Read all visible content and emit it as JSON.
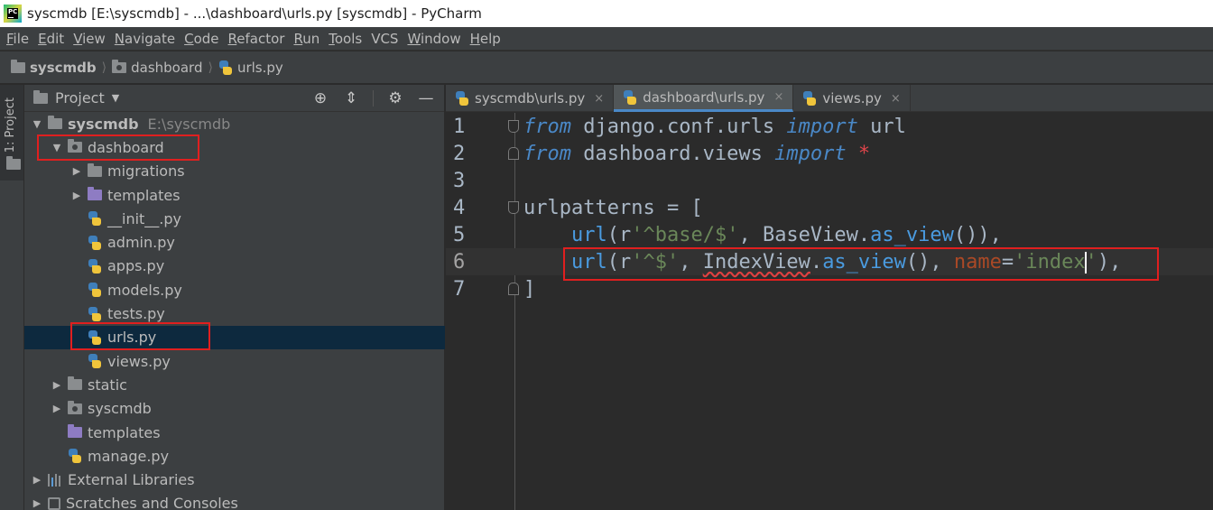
{
  "window": {
    "title": "syscmdb [E:\\syscmdb] - ...\\dashboard\\urls.py [syscmdb] - PyCharm",
    "app_icon_text": "PC"
  },
  "menu": {
    "items": [
      {
        "mnemonic": "F",
        "rest": "ile"
      },
      {
        "mnemonic": "E",
        "rest": "dit"
      },
      {
        "mnemonic": "V",
        "rest": "iew"
      },
      {
        "mnemonic": "N",
        "rest": "avigate"
      },
      {
        "mnemonic": "C",
        "rest": "ode"
      },
      {
        "mnemonic": "R",
        "rest": "efactor"
      },
      {
        "mnemonic": "R",
        "rest": "un"
      },
      {
        "mnemonic": "T",
        "rest": "ools"
      },
      {
        "mnemonic": "",
        "rest": "VCS"
      },
      {
        "mnemonic": "W",
        "rest": "indow"
      },
      {
        "mnemonic": "H",
        "rest": "elp"
      }
    ]
  },
  "breadcrumb": {
    "items": [
      "syscmdb",
      "dashboard",
      "urls.py"
    ]
  },
  "toolstrip": {
    "project_tab": "1: Project"
  },
  "project_panel": {
    "title": "Project",
    "tree": [
      {
        "indent": 0,
        "arrow": "open",
        "icon": "folder",
        "name": "syscmdb",
        "bold": true,
        "hint": "E:\\syscmdb"
      },
      {
        "indent": 1,
        "arrow": "open",
        "icon": "folder-dot",
        "name": "dashboard"
      },
      {
        "indent": 2,
        "arrow": "closed",
        "icon": "folder",
        "name": "migrations"
      },
      {
        "indent": 2,
        "arrow": "closed",
        "icon": "folder-purple",
        "name": "templates"
      },
      {
        "indent": 2,
        "arrow": "none",
        "icon": "py",
        "name": "__init__.py"
      },
      {
        "indent": 2,
        "arrow": "none",
        "icon": "py",
        "name": "admin.py"
      },
      {
        "indent": 2,
        "arrow": "none",
        "icon": "py",
        "name": "apps.py"
      },
      {
        "indent": 2,
        "arrow": "none",
        "icon": "py",
        "name": "models.py"
      },
      {
        "indent": 2,
        "arrow": "none",
        "icon": "py",
        "name": "tests.py"
      },
      {
        "indent": 2,
        "arrow": "none",
        "icon": "py",
        "name": "urls.py",
        "selected": true
      },
      {
        "indent": 2,
        "arrow": "none",
        "icon": "py",
        "name": "views.py"
      },
      {
        "indent": 1,
        "arrow": "closed",
        "icon": "folder",
        "name": "static"
      },
      {
        "indent": 1,
        "arrow": "closed",
        "icon": "folder-dot",
        "name": "syscmdb"
      },
      {
        "indent": 1,
        "arrow": "none",
        "icon": "folder-purple",
        "name": "templates"
      },
      {
        "indent": 1,
        "arrow": "none",
        "icon": "py",
        "name": "manage.py"
      },
      {
        "indent": 0,
        "arrow": "closed",
        "icon": "library",
        "name": "External Libraries"
      },
      {
        "indent": 0,
        "arrow": "closed",
        "icon": "scratch",
        "name": "Scratches and Consoles"
      }
    ]
  },
  "editor": {
    "tabs": [
      {
        "label": "syscmdb\\urls.py",
        "active": false
      },
      {
        "label": "dashboard\\urls.py",
        "active": true
      },
      {
        "label": "views.py",
        "active": false
      }
    ],
    "close_glyph": "×",
    "lines": [
      {
        "num": "1"
      },
      {
        "num": "2"
      },
      {
        "num": "3"
      },
      {
        "num": "4"
      },
      {
        "num": "5"
      },
      {
        "num": "6",
        "current": true
      },
      {
        "num": "7"
      }
    ],
    "code": {
      "l1": {
        "kw1": "from",
        "mod": " django.conf.urls ",
        "kw2": "import",
        "name": " url"
      },
      "l2": {
        "kw1": "from",
        "mod": " dashboard.views ",
        "kw2": "import",
        "star": " *"
      },
      "l4": {
        "var": "urlpatterns",
        "op": " = ["
      },
      "l5": {
        "indent": "    ",
        "fn": "url",
        "p1": "(r",
        "s": "'^base/$'",
        "p2": ", BaseView.",
        "call": "as_view",
        "p3": "()),"
      },
      "l6": {
        "indent": "    ",
        "fn": "url",
        "p1": "(r",
        "s": "'^$'",
        "p2": ", ",
        "cls": "IndexView",
        "dot": ".",
        "call": "as_view",
        "p3": "(), ",
        "param": "name",
        "eq": "=",
        "s2a": "'index",
        "s2b": "'",
        "p4": "),"
      },
      "l7": {
        "close": "]"
      }
    }
  }
}
